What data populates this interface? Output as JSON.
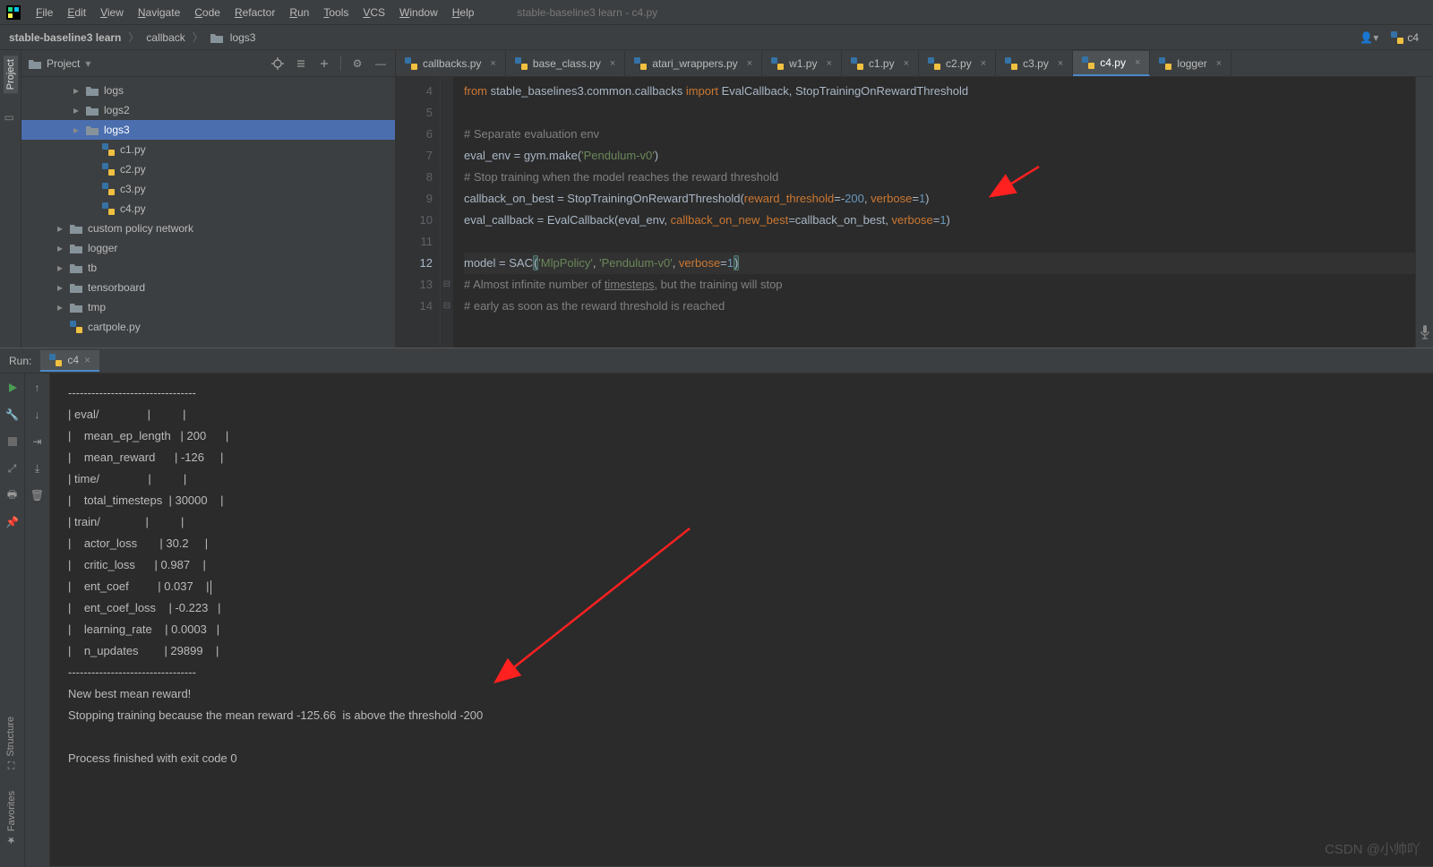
{
  "window_title": "stable-baseline3 learn - c4.py",
  "menubar": [
    "File",
    "Edit",
    "View",
    "Navigate",
    "Code",
    "Refactor",
    "Run",
    "Tools",
    "VCS",
    "Window",
    "Help"
  ],
  "breadcrumb": {
    "project": "stable-baseline3 learn",
    "folder": "callback",
    "subfolder": "logs3",
    "current_file": "c4"
  },
  "project_panel": {
    "title": "Project",
    "tree": [
      {
        "label": "logs",
        "kind": "folder",
        "indent": 2,
        "chev": "right"
      },
      {
        "label": "logs2",
        "kind": "folder",
        "indent": 2,
        "chev": "right"
      },
      {
        "label": "logs3",
        "kind": "folder",
        "indent": 2,
        "chev": "right",
        "selected": true
      },
      {
        "label": "c1.py",
        "kind": "py",
        "indent": 3
      },
      {
        "label": "c2.py",
        "kind": "py",
        "indent": 3
      },
      {
        "label": "c3.py",
        "kind": "py",
        "indent": 3
      },
      {
        "label": "c4.py",
        "kind": "py",
        "indent": 3
      },
      {
        "label": "custom policy network",
        "kind": "folder",
        "indent": 1,
        "chev": "right"
      },
      {
        "label": "logger",
        "kind": "folder",
        "indent": 1,
        "chev": "right"
      },
      {
        "label": "tb",
        "kind": "folder",
        "indent": 1,
        "chev": "right"
      },
      {
        "label": "tensorboard",
        "kind": "folder",
        "indent": 1,
        "chev": "right"
      },
      {
        "label": "tmp",
        "kind": "folder",
        "indent": 1,
        "chev": "right"
      },
      {
        "label": "cartpole.py",
        "kind": "py",
        "indent": 1
      }
    ]
  },
  "left_tabs": {
    "project": "Project"
  },
  "editor": {
    "tabs": [
      {
        "label": "callbacks.py"
      },
      {
        "label": "base_class.py"
      },
      {
        "label": "atari_wrappers.py"
      },
      {
        "label": "w1.py"
      },
      {
        "label": "c1.py"
      },
      {
        "label": "c2.py"
      },
      {
        "label": "c3.py"
      },
      {
        "label": "c4.py",
        "active": true
      },
      {
        "label": "logger"
      }
    ],
    "first_line_no": 4,
    "current_line_no": 12,
    "lines": [
      {
        "n": 4,
        "html": "<span class='kw'>from</span> stable_baselines3.common.callbacks <span class='kw'>import</span> EvalCallback, StopTrainingOnRewardThreshold"
      },
      {
        "n": 5,
        "html": ""
      },
      {
        "n": 6,
        "html": "<span class='cmt'># Separate evaluation env</span>"
      },
      {
        "n": 7,
        "html": "eval_env = gym.make(<span class='str'>'Pendulum-v0'</span>)"
      },
      {
        "n": 8,
        "html": "<span class='cmt'># Stop training when the model reaches the reward threshold</span>"
      },
      {
        "n": 9,
        "html": "callback_on_best = StopTrainingOnRewardThreshold(<span class='param'>reward_threshold</span>=-<span class='num'>200</span>, <span class='param'>verbose</span>=<span class='num'>1</span>)"
      },
      {
        "n": 10,
        "html": "eval_callback = EvalCallback(eval_env, <span class='param'>callback_on_new_best</span>=callback_on_best, <span class='param'>verbose</span>=<span class='num'>1</span>)"
      },
      {
        "n": 11,
        "html": ""
      },
      {
        "n": 12,
        "html": "model = SAC<span class='paren-hl'>(</span><span class='str'>'MlpPolicy'</span>, <span class='str'>'Pendulum-v0'</span>, <span class='param'>verbose</span>=<span class='num'>1</span><span class='paren-hl'>)</span>",
        "current": true
      },
      {
        "n": 13,
        "html": "<span class='cmt'># Almost infinite number of <u>timesteps</u>, but the training will stop</span>"
      },
      {
        "n": 14,
        "html": "<span class='cmt'># early as soon as the reward threshold is reached</span>"
      }
    ]
  },
  "run": {
    "label": "Run:",
    "tab": "c4",
    "rows": [
      "---------------------------------",
      "| eval/               |          |",
      "|    mean_ep_length   | 200      |",
      "|    mean_reward      | -126     |",
      "| time/               |          |",
      "|    total_timesteps  | 30000    |",
      "| train/              |          |",
      "|    actor_loss       | 30.2     |",
      "|    critic_loss      | 0.987    |",
      "|    ent_coef         | 0.037    |",
      "|    ent_coef_loss    | -0.223   |",
      "|    learning_rate    | 0.0003   |",
      "|    n_updates        | 29899    |",
      "---------------------------------",
      "New best mean reward!",
      "Stopping training because the mean reward -125.66  is above the threshold -200",
      "",
      "Process finished with exit code 0"
    ]
  },
  "bottom_tabs": {
    "structure": "Structure",
    "favorites": "Favorites"
  },
  "watermark": "CSDN @小帅吖"
}
